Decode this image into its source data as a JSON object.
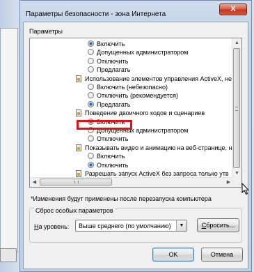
{
  "dialog": {
    "title": "Параметры безопасности - зона Интернета",
    "close_glyph": "X"
  },
  "settings": {
    "group_label": "Параметры",
    "rows": [
      {
        "kind": "radio",
        "checked": true,
        "label": "Включить"
      },
      {
        "kind": "radio",
        "checked": false,
        "label": "Допущенных администратором"
      },
      {
        "kind": "radio",
        "checked": false,
        "label": "Отключить"
      },
      {
        "kind": "radio",
        "checked": false,
        "label": "Предлагать"
      },
      {
        "kind": "category",
        "label": "Использование элементов управления ActiveX, не помече"
      },
      {
        "kind": "radio",
        "checked": false,
        "label": "Включить (небезопасно)"
      },
      {
        "kind": "radio",
        "checked": false,
        "label": "Отключить (рекомендуется)"
      },
      {
        "kind": "radio",
        "checked": true,
        "label": "Предлагать"
      },
      {
        "kind": "category",
        "label": "Поведение двоичного кодов и сценариев"
      },
      {
        "kind": "radio",
        "checked": true,
        "label": "Включить"
      },
      {
        "kind": "radio",
        "checked": false,
        "label": "Допущенных администратором"
      },
      {
        "kind": "radio",
        "checked": false,
        "label": "Отключить"
      },
      {
        "kind": "category",
        "label": "Показывать видео и анимацию на веб-странице, не испо"
      },
      {
        "kind": "radio",
        "checked": false,
        "label": "Включить"
      },
      {
        "kind": "radio",
        "checked": true,
        "label": "Отключить"
      },
      {
        "kind": "category",
        "label": "Разрешать запуск ActiveX без запроса только утв"
      }
    ]
  },
  "note": "*Изменения будут применены после перезапуска компьютера",
  "reset": {
    "group_title": "Сброс особых параметров",
    "level_label_prefix": "Н",
    "level_label_rest": "а уровень:",
    "level_value": "Выше среднего (по умолчанию)",
    "reset_button_prefix": "С",
    "reset_button_rest": "бросить..."
  },
  "buttons": {
    "ok": "OK",
    "cancel": "Отмена"
  },
  "colors": {
    "highlight": "#e0101a",
    "close_button": "#c0381b"
  }
}
